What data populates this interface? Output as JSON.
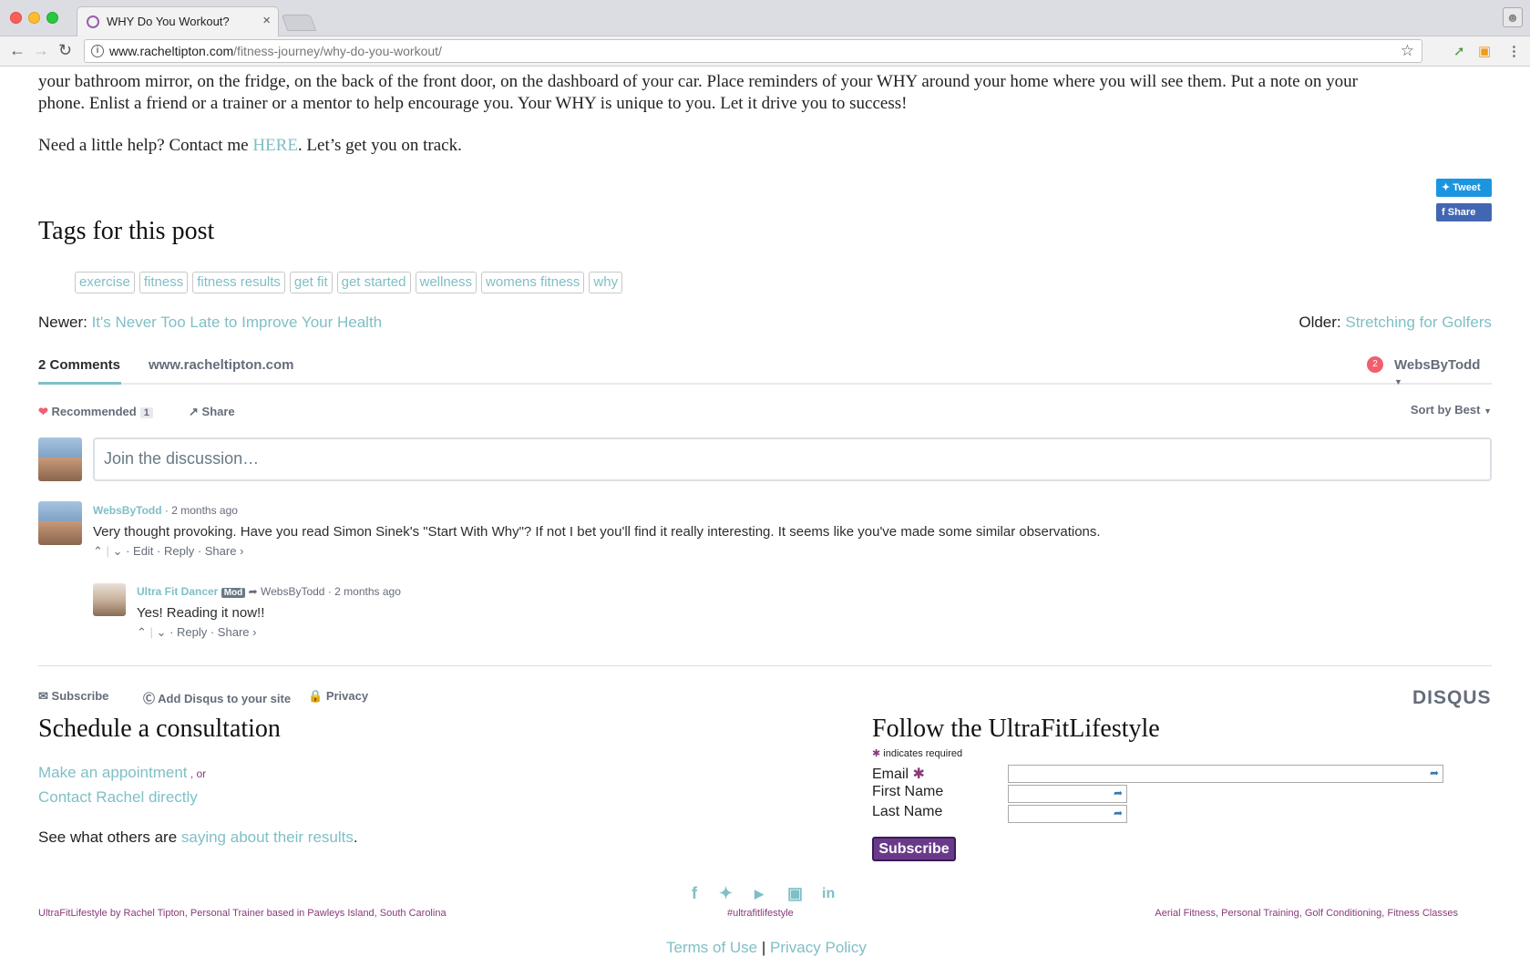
{
  "browser": {
    "tab_title": "WHY Do You Workout?",
    "tab_close": "×",
    "url_domain": "www.racheltipton.com",
    "url_path": "/fitness-journey/why-do-you-workout/"
  },
  "article": {
    "para1_line1": "your bathroom mirror, on the fridge, on the back of the front door, on the dashboard of your car. Place reminders of your WHY around your home where you will see them. Put a note on your",
    "para1_line2": "phone. Enlist a friend or a trainer or a mentor to help encourage you. Your WHY is unique to you. Let it drive you to success!",
    "help_prefix": "Need a little help? Contact me ",
    "help_link": "HERE",
    "help_suffix": ". Let’s get you on track."
  },
  "share": {
    "tweet": "Tweet",
    "share": "Share"
  },
  "tags_title": "Tags for this post",
  "tags": [
    "exercise",
    "fitness",
    "fitness results",
    "get fit",
    "get started",
    "wellness",
    "womens fitness",
    "why"
  ],
  "post_nav": {
    "newer_label": "Newer: ",
    "newer_link": "It's Never Too Late to Improve Your Health",
    "older_label": "Older: ",
    "older_link": "Stretching for Golfers"
  },
  "disqus": {
    "comments_tab": "2 Comments",
    "site_tab": "www.racheltipton.com",
    "notif_count": "2",
    "user": "WebsByTodd",
    "recommended": "Recommended",
    "recommended_count": "1",
    "share": "Share",
    "sort": "Sort by Best",
    "join_placeholder": "Join the discussion…",
    "comments": [
      {
        "author": "WebsByTodd",
        "time": "· 2 months ago",
        "text": "Very thought provoking. Have you read Simon Sinek's \"Start With Why\"? If not I bet you'll find it really interesting. It seems like you've made some similar observations.",
        "actions": "· Edit · Reply · Share ›"
      },
      {
        "author": "Ultra Fit Dancer",
        "badge": "Mod",
        "reply_to": "WebsByTodd",
        "time": "· 2 months ago",
        "text": "Yes! Reading it now!!",
        "actions": "· Reply · Share ›"
      }
    ],
    "footer_subscribe": "Subscribe",
    "footer_add": "Add Disqus to your site",
    "footer_privacy": "Privacy",
    "logo": "DISQUS"
  },
  "consult": {
    "title": "Schedule a consultation",
    "appointment_link": "Make an appointment",
    "or": " , or",
    "contact_link": "Contact Rachel directly",
    "see_prefix": "See what others are ",
    "see_link": "saying about their results",
    "see_suffix": "."
  },
  "follow": {
    "title": "Follow the UltraFitLifestyle",
    "required_note": "indicates required",
    "email_label": "Email",
    "first_label": "First Name",
    "last_label": "Last Name",
    "subscribe": "Subscribe"
  },
  "footer": {
    "left": "UltraFitLifestyle by Rachel Tipton, Personal Trainer based in Pawleys Island, South Carolina",
    "hashtag": "#ultrafitlifestyle",
    "right": "Aerial Fitness, Personal Training, Golf Conditioning, Fitness Classes",
    "terms": "Terms of Use",
    "separator": "|",
    "privacy": "Privacy Policy"
  },
  "colors": {
    "accent": "#7fbfc6",
    "brand_purple": "#6a3a8a",
    "disqus_gray": "#656c7a"
  }
}
